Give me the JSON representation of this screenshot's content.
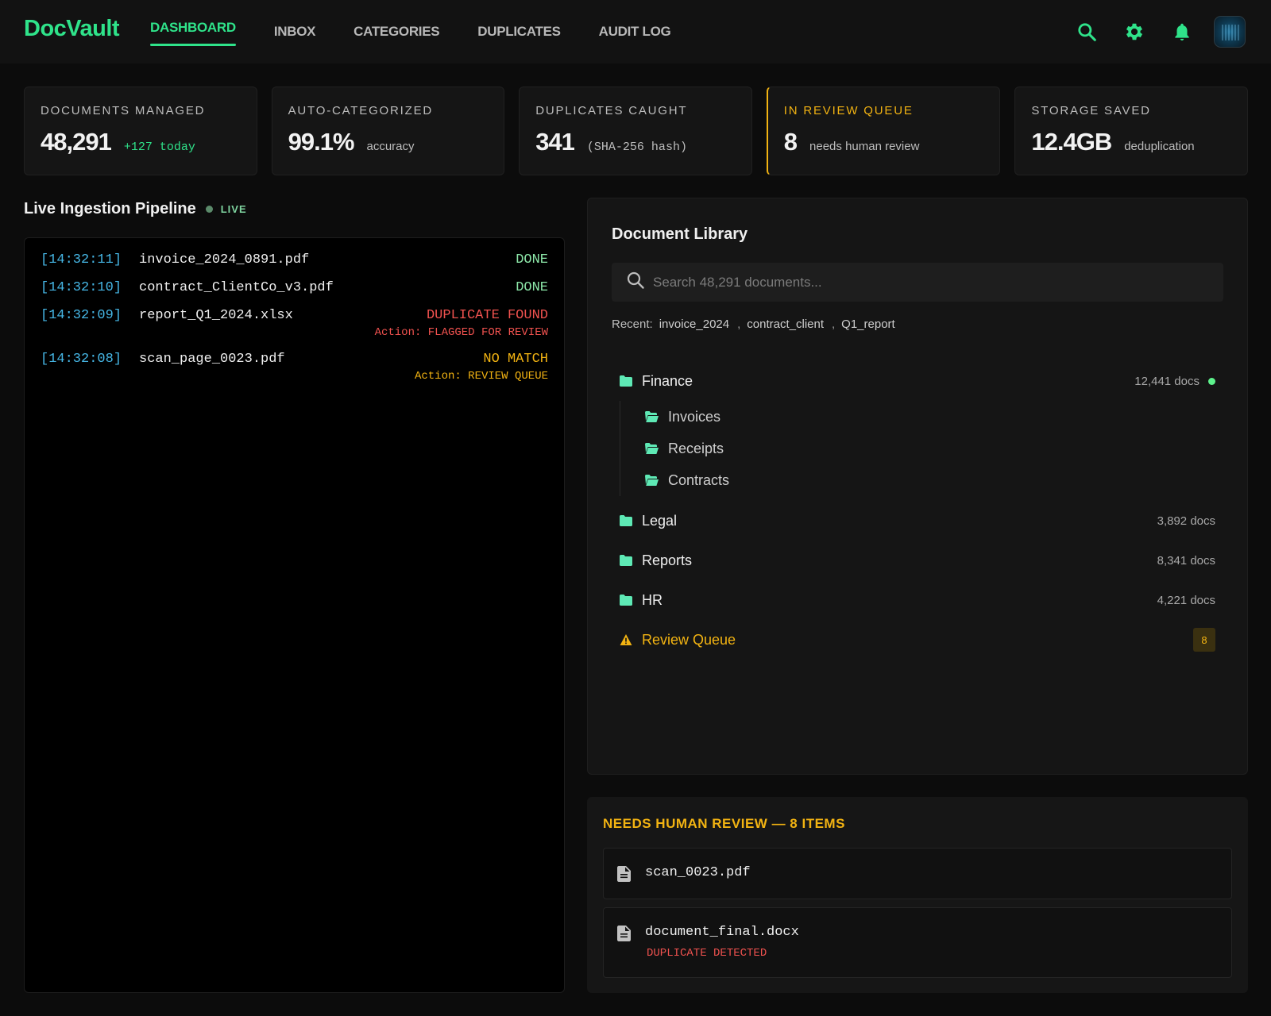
{
  "app": {
    "name": "DocVault",
    "accent": "#2fe38a",
    "warning": "#f2b312",
    "danger": "#f0524f"
  },
  "nav": {
    "tabs": [
      {
        "label": "DASHBOARD",
        "active": true
      },
      {
        "label": "INBOX",
        "active": false
      },
      {
        "label": "CATEGORIES",
        "active": false
      },
      {
        "label": "DUPLICATES",
        "active": false
      },
      {
        "label": "AUDIT LOG",
        "active": false
      }
    ],
    "icons": [
      "search-icon",
      "gear-icon",
      "bell-icon",
      "avatar"
    ]
  },
  "stats": [
    {
      "label": "DOCUMENTS MANAGED",
      "value": "48,291",
      "sub": "+127 today"
    },
    {
      "label": "AUTO-CATEGORIZED",
      "value": "99.1%",
      "sub": "accuracy"
    },
    {
      "label": "DUPLICATES CAUGHT",
      "value": "341",
      "sub": "(SHA-256 hash)"
    },
    {
      "label": "IN REVIEW QUEUE",
      "value": "8",
      "sub": "needs human review"
    },
    {
      "label": "STORAGE SAVED",
      "value": "12.4GB",
      "sub": "deduplication"
    }
  ],
  "pipeline": {
    "title": "Live Ingestion Pipeline",
    "live_label": "LIVE",
    "logs": [
      {
        "time": "[14:32:11]",
        "file": "invoice_2024_0891.pdf",
        "status": "DONE",
        "action": ""
      },
      {
        "time": "[14:32:10]",
        "file": "contract_ClientCo_v3.pdf",
        "status": "DONE",
        "action": ""
      },
      {
        "time": "[14:32:09]",
        "file": "report_Q1_2024.xlsx",
        "status": "DUPLICATE FOUND",
        "action": "Action: FLAGGED FOR REVIEW"
      },
      {
        "time": "[14:32:08]",
        "file": "scan_page_0023.pdf",
        "status": "NO MATCH",
        "action": "Action: REVIEW QUEUE"
      }
    ]
  },
  "library": {
    "title": "Document Library",
    "search_placeholder": "Search 48,291 documents...",
    "recent_label": "Recent:",
    "recent": [
      "invoice_2024",
      "contract_client",
      "Q1_report"
    ],
    "recent_sep": ",",
    "folders": [
      {
        "name": "Finance",
        "count": "12,441 docs",
        "children": [
          "Invoices",
          "Receipts",
          "Contracts"
        ]
      },
      {
        "name": "Legal",
        "count": "3,892 docs"
      },
      {
        "name": "Reports",
        "count": "8,341 docs"
      },
      {
        "name": "HR",
        "count": "4,221 docs"
      }
    ],
    "review_queue": {
      "label": "Review Queue",
      "count": "8"
    }
  },
  "review_panel": {
    "title": "NEEDS HUMAN REVIEW — 8 ITEMS",
    "items": [
      {
        "file": "scan_0023.pdf",
        "flag": ""
      },
      {
        "file": "document_final.docx",
        "flag": "DUPLICATE DETECTED"
      }
    ]
  }
}
